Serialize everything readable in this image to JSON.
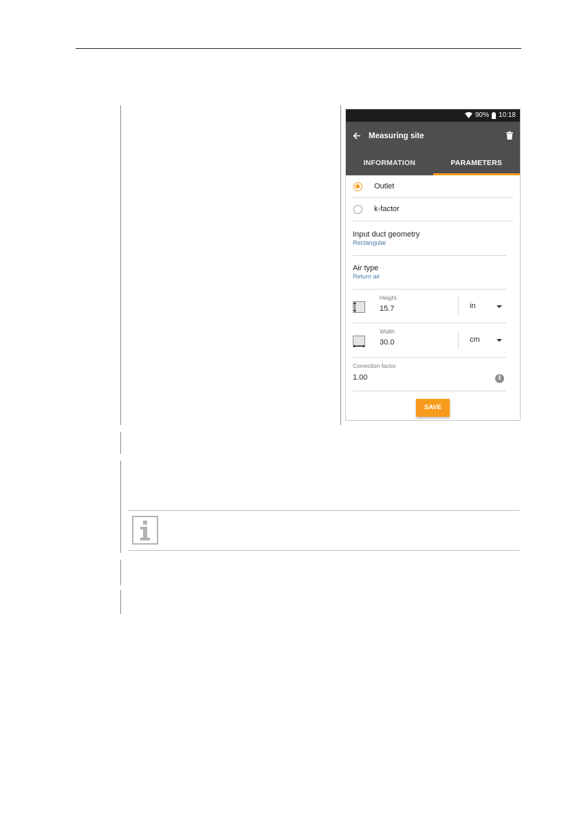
{
  "phone": {
    "status": {
      "battery_percent": "90%",
      "time": "10:18"
    },
    "appbar": {
      "title": "Measuring site"
    },
    "tabs": [
      {
        "label": "INFORMATION",
        "active": false
      },
      {
        "label": "PARAMETERS",
        "active": true
      }
    ],
    "options": [
      {
        "label": "Outlet",
        "selected": true
      },
      {
        "label": "k-factor",
        "selected": false
      }
    ],
    "duct_geometry": {
      "title": "Input duct geometry",
      "value": "Rectangular"
    },
    "air_type": {
      "title": "Air type",
      "value": "Return air"
    },
    "height": {
      "label": "Height",
      "value": "15.7",
      "unit": "in"
    },
    "width": {
      "label": "Width",
      "value": "30.0",
      "unit": "cm"
    },
    "correction": {
      "label": "Correction factor",
      "value": "1.00"
    },
    "save_label": "SAVE",
    "colors": {
      "accent": "#f89b1c",
      "appbar": "#4e4e4e",
      "statusbar": "#1c1c1c",
      "link": "#4a7aa8"
    }
  }
}
